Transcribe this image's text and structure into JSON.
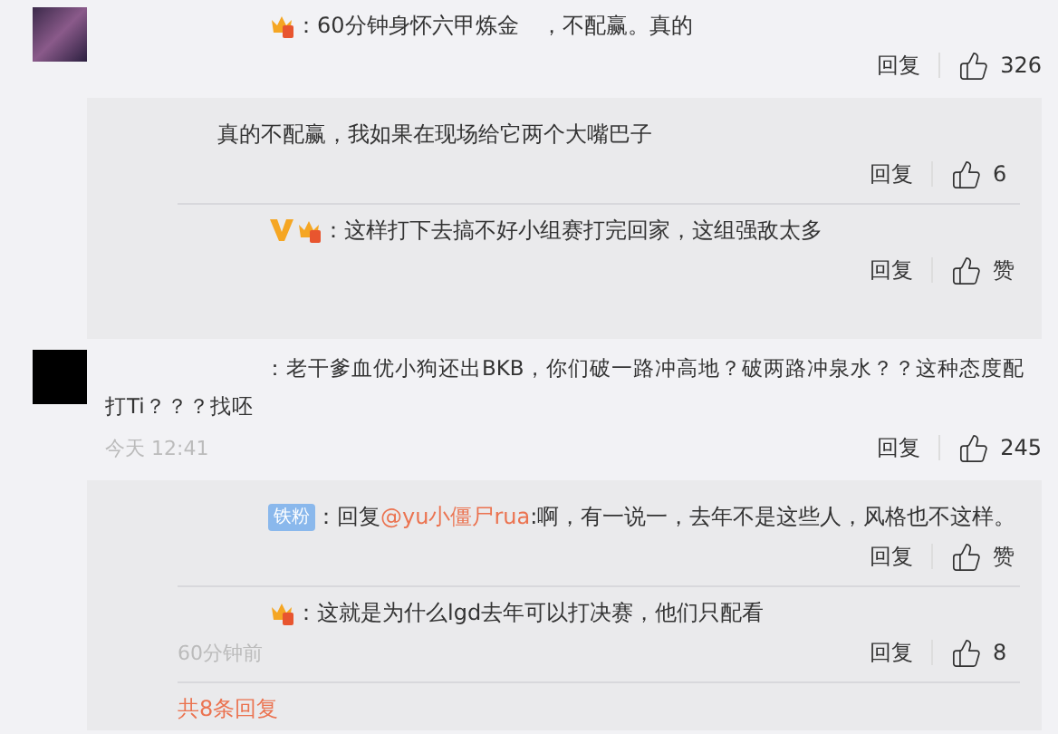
{
  "comments": [
    {
      "avatar": {
        "kind": "photo"
      },
      "badges": [
        {
          "kind": "crown"
        }
      ],
      "text": "：60分钟身怀六甲炼金　，不配赢。真的",
      "reply_label": "回复",
      "likes": "326",
      "replies": [
        {
          "text": "真的不配赢，我如果在现场给它两个大嘴巴子",
          "reply_label": "回复",
          "likes": "6"
        },
        {
          "badges": [
            {
              "kind": "v"
            },
            {
              "kind": "crown"
            }
          ],
          "text": "：这样打下去搞不好小组赛打完回家，这组强敌太多",
          "reply_label": "回复",
          "likes": "赞"
        }
      ]
    },
    {
      "avatar": {
        "kind": "dark"
      },
      "text": "：老干爹血优小狗还出BKB，你们破一路冲高地？破两路冲泉水？？这种态度配打Ti？？？找呸",
      "time": "今天 12:41",
      "reply_label": "回复",
      "likes": "245",
      "replies": [
        {
          "badges": [
            {
              "kind": "fan",
              "label": "铁粉"
            }
          ],
          "prefix": "：回复",
          "mention": "@yu小僵尸rua",
          "text": ":啊，有一说一，去年不是这些人，风格也不这样。",
          "reply_label": "回复",
          "likes": "赞"
        },
        {
          "badges": [
            {
              "kind": "crown"
            }
          ],
          "text": "：这就是为什么lgd去年可以打决赛，他们只配看",
          "time": "60分钟前",
          "reply_label": "回复",
          "likes": "8"
        }
      ],
      "more": "共8条回复"
    }
  ]
}
